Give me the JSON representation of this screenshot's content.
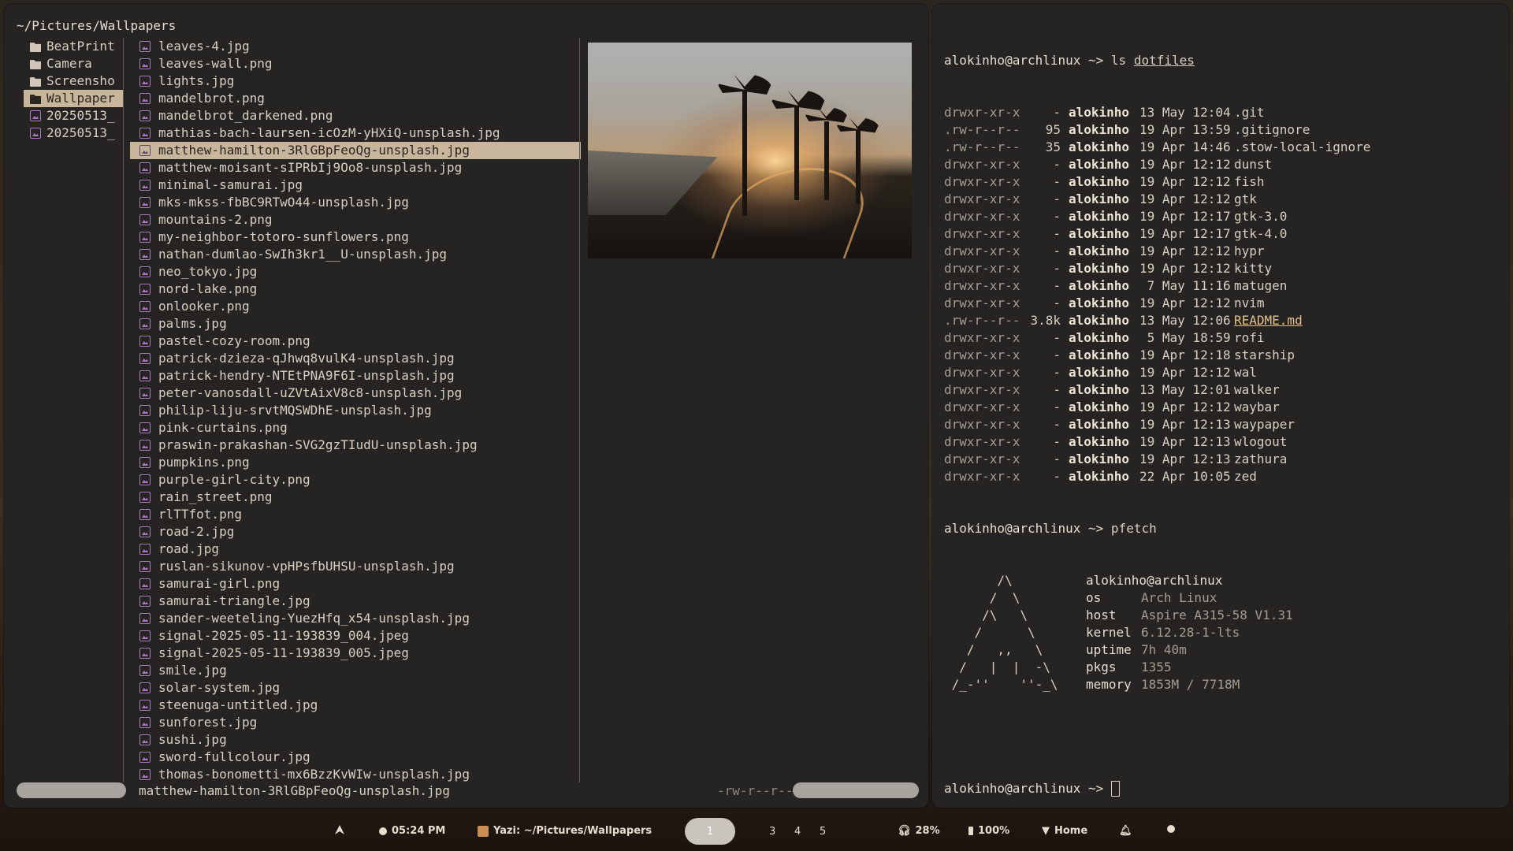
{
  "yazi": {
    "cwd": "~/Pictures/Wallpapers",
    "parent": [
      {
        "name": "BeatPrint",
        "type": "folder"
      },
      {
        "name": "Camera",
        "type": "folder"
      },
      {
        "name": "Screensho",
        "type": "folder"
      },
      {
        "name": "Wallpaper",
        "type": "folder",
        "selected": true
      },
      {
        "name": "20250513_",
        "type": "image"
      },
      {
        "name": "20250513_",
        "type": "image"
      }
    ],
    "files": [
      "leaves-4.jpg",
      "leaves-wall.png",
      "lights.jpg",
      "mandelbrot.png",
      "mandelbrot_darkened.png",
      "mathias-bach-laursen-icOzM-yHXiQ-unsplash.jpg",
      "matthew-hamilton-3RlGBpFeoQg-unsplash.jpg",
      "matthew-moisant-sIPRbIj9Oo8-unsplash.jpg",
      "minimal-samurai.jpg",
      "mks-mkss-fbBC9RTwO44-unsplash.jpg",
      "mountains-2.png",
      "my-neighbor-totoro-sunflowers.png",
      "nathan-dumlao-SwIh3kr1__U-unsplash.jpg",
      "neo_tokyo.jpg",
      "nord-lake.png",
      "onlooker.png",
      "palms.jpg",
      "pastel-cozy-room.png",
      "patrick-dzieza-qJhwq8vulK4-unsplash.jpg",
      "patrick-hendry-NTEtPNA9F6I-unsplash.jpg",
      "peter-vanosdall-uZVtAixV8c8-unsplash.jpg",
      "philip-liju-srvtMQSWDhE-unsplash.jpg",
      "pink-curtains.png",
      "praswin-prakashan-SVG2gzTIudU-unsplash.jpg",
      "pumpkins.png",
      "purple-girl-city.png",
      "rain_street.png",
      "rlTTfot.png",
      "road-2.jpg",
      "road.jpg",
      "ruslan-sikunov-vpHPsfbUHSU-unsplash.jpg",
      "samurai-girl.png",
      "samurai-triangle.jpg",
      "sander-weeteling-YuezHfq_x54-unsplash.jpg",
      "signal-2025-05-11-193839_004.jpeg",
      "signal-2025-05-11-193839_005.jpeg",
      "smile.jpg",
      "solar-system.jpg",
      "steenuga-untitled.jpg",
      "sunforest.jpg",
      "sushi.jpg",
      "sword-fullcolour.jpg",
      "thomas-bonometti-mx6BzzKvWIw-unsplash.jpg"
    ],
    "selected_file": "matthew-hamilton-3RlGBpFeoQg-unsplash.jpg",
    "status_filename": "matthew-hamilton-3RlGBpFeoQg-unsplash.jpg",
    "status_perms": "-rw-r--r--"
  },
  "terminal": {
    "prompt": "alokinho@archlinux ~> ",
    "cmd1": "ls ",
    "cmd1_arg": "dotfiles",
    "listing": [
      {
        "perm": "drwxr-xr-x",
        "size": "-",
        "user": "alokinho",
        "date": "13 May 12:04",
        "name": ".git"
      },
      {
        "perm": ".rw-r--r--",
        "size": "95",
        "user": "alokinho",
        "date": "19 Apr 13:59",
        "name": ".gitignore"
      },
      {
        "perm": ".rw-r--r--",
        "size": "35",
        "user": "alokinho",
        "date": "19 Apr 14:46",
        "name": ".stow-local-ignore"
      },
      {
        "perm": "drwxr-xr-x",
        "size": "-",
        "user": "alokinho",
        "date": "19 Apr 12:12",
        "name": "dunst"
      },
      {
        "perm": "drwxr-xr-x",
        "size": "-",
        "user": "alokinho",
        "date": "19 Apr 12:12",
        "name": "fish"
      },
      {
        "perm": "drwxr-xr-x",
        "size": "-",
        "user": "alokinho",
        "date": "19 Apr 12:12",
        "name": "gtk"
      },
      {
        "perm": "drwxr-xr-x",
        "size": "-",
        "user": "alokinho",
        "date": "19 Apr 12:17",
        "name": "gtk-3.0"
      },
      {
        "perm": "drwxr-xr-x",
        "size": "-",
        "user": "alokinho",
        "date": "19 Apr 12:17",
        "name": "gtk-4.0"
      },
      {
        "perm": "drwxr-xr-x",
        "size": "-",
        "user": "alokinho",
        "date": "19 Apr 12:12",
        "name": "hypr"
      },
      {
        "perm": "drwxr-xr-x",
        "size": "-",
        "user": "alokinho",
        "date": "19 Apr 12:12",
        "name": "kitty"
      },
      {
        "perm": "drwxr-xr-x",
        "size": "-",
        "user": "alokinho",
        "date": " 7 May 11:16",
        "name": "matugen"
      },
      {
        "perm": "drwxr-xr-x",
        "size": "-",
        "user": "alokinho",
        "date": "19 Apr 12:12",
        "name": "nvim"
      },
      {
        "perm": ".rw-r--r--",
        "size": "3.8k",
        "user": "alokinho",
        "date": "13 May 12:06",
        "name": "README.md",
        "underline": true
      },
      {
        "perm": "drwxr-xr-x",
        "size": "-",
        "user": "alokinho",
        "date": " 5 May 18:59",
        "name": "rofi"
      },
      {
        "perm": "drwxr-xr-x",
        "size": "-",
        "user": "alokinho",
        "date": "19 Apr 12:18",
        "name": "starship"
      },
      {
        "perm": "drwxr-xr-x",
        "size": "-",
        "user": "alokinho",
        "date": "19 Apr 12:12",
        "name": "wal"
      },
      {
        "perm": "drwxr-xr-x",
        "size": "-",
        "user": "alokinho",
        "date": "13 May 12:01",
        "name": "walker"
      },
      {
        "perm": "drwxr-xr-x",
        "size": "-",
        "user": "alokinho",
        "date": "19 Apr 12:12",
        "name": "waybar"
      },
      {
        "perm": "drwxr-xr-x",
        "size": "-",
        "user": "alokinho",
        "date": "19 Apr 12:13",
        "name": "waypaper"
      },
      {
        "perm": "drwxr-xr-x",
        "size": "-",
        "user": "alokinho",
        "date": "19 Apr 12:13",
        "name": "wlogout"
      },
      {
        "perm": "drwxr-xr-x",
        "size": "-",
        "user": "alokinho",
        "date": "19 Apr 12:13",
        "name": "zathura"
      },
      {
        "perm": "drwxr-xr-x",
        "size": "-",
        "user": "alokinho",
        "date": "22 Apr 10:05",
        "name": "zed"
      }
    ],
    "cmd2": "pfetch",
    "pfetch_art": [
      "       /\\         ",
      "      /  \\        ",
      "     /\\   \\       ",
      "    /      \\      ",
      "   /   ,,   \\     ",
      "  /   |  |  -\\    ",
      " /_-''    ''-_\\   "
    ],
    "pfetch_title": "alokinho@archlinux",
    "pfetch_info": [
      {
        "key": "os",
        "value": "Arch Linux"
      },
      {
        "key": "host",
        "value": "Aspire A315-58 V1.31"
      },
      {
        "key": "kernel",
        "value": "6.12.28-1-lts"
      },
      {
        "key": "uptime",
        "value": "7h 40m"
      },
      {
        "key": "pkgs",
        "value": "1355"
      },
      {
        "key": "memory",
        "value": "1853M / 7718M"
      }
    ]
  },
  "bar": {
    "launcher_icon": "arch-icon",
    "time": "05:24 PM",
    "window_title": "Yazi: ~/Pictures/Wallpapers",
    "workspaces": [
      "1",
      "3",
      "4",
      "5"
    ],
    "active_workspace": "1",
    "volume": "28%",
    "battery": "100%",
    "network": "Home",
    "notification_icon": "bell-icon",
    "power_icon": "power-icon"
  }
}
